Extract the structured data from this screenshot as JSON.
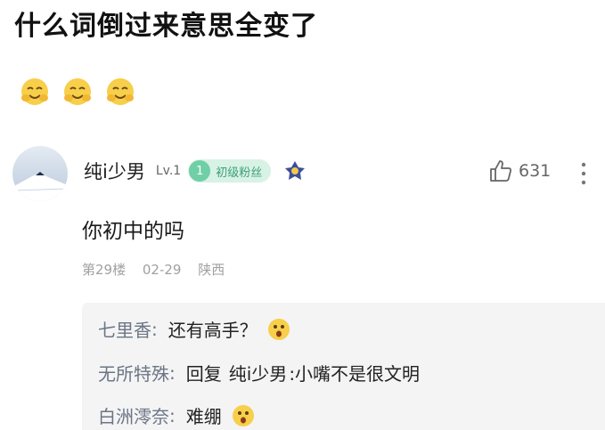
{
  "post": {
    "title": "什么词倒过来意思全变了",
    "emojis": [
      "hug-emoji",
      "hug-emoji",
      "hug-emoji"
    ]
  },
  "comment": {
    "username": "纯i少男",
    "level": "Lv.1",
    "fan_badge": {
      "number": "1",
      "label": "初级粉丝"
    },
    "likes": "631",
    "text": "你初中的吗",
    "floor": "第29楼",
    "date": "02-29",
    "location": "陕西"
  },
  "replies": [
    {
      "name": "七里香",
      "text": "还有高手？",
      "emoji": "surprised-emoji"
    },
    {
      "name": "无所特殊",
      "label": "回复",
      "mention": "纯i少男",
      "text": ":小嘴不是很文明"
    },
    {
      "name": "白洲澪奈",
      "text": "难绷",
      "emoji": "surprised-emoji"
    }
  ],
  "colors": {
    "meta_gray": "#a0a0a0",
    "reply_name": "#6b7585",
    "badge_green": "#6fcfa6",
    "badge_bg": "#d8f2e6",
    "reply_bg": "#f4f4f5"
  }
}
